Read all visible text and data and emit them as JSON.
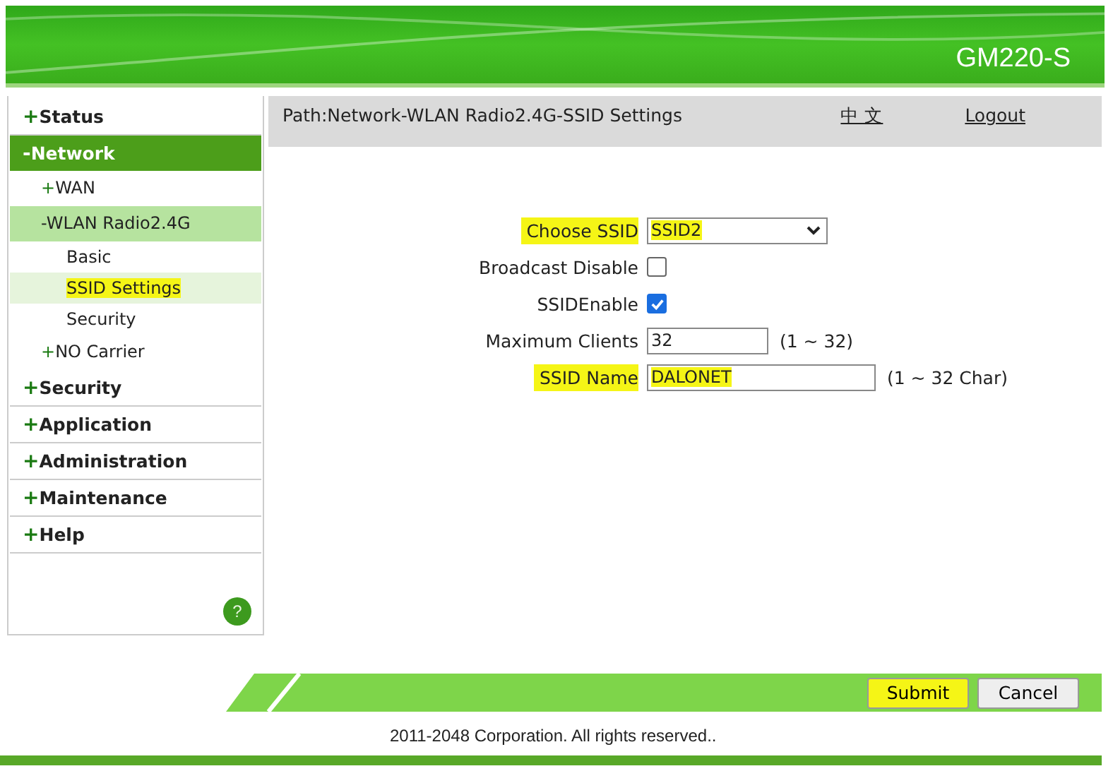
{
  "header": {
    "model": "GM220-S"
  },
  "menu": [
    {
      "toggle": "+",
      "label": "Status",
      "selected": false
    },
    {
      "toggle": "-",
      "label": "Network",
      "selected": true,
      "children": [
        {
          "toggle": "+",
          "label": "WAN",
          "selected": false
        },
        {
          "toggle": "-",
          "label": "WLAN Radio2.4G",
          "selected": true,
          "children": [
            {
              "label": "Basic",
              "selected": false,
              "highlighted": false
            },
            {
              "label": "SSID Settings",
              "selected": true,
              "highlighted": true
            },
            {
              "label": "Security",
              "selected": false,
              "highlighted": false
            }
          ]
        },
        {
          "toggle": "+",
          "label": "NO Carrier",
          "selected": false
        }
      ]
    },
    {
      "toggle": "+",
      "label": "Security",
      "selected": false
    },
    {
      "toggle": "+",
      "label": "Application",
      "selected": false
    },
    {
      "toggle": "+",
      "label": "Administration",
      "selected": false
    },
    {
      "toggle": "+",
      "label": "Maintenance",
      "selected": false
    },
    {
      "toggle": "+",
      "label": "Help",
      "selected": false
    }
  ],
  "help_button": {
    "label": "?"
  },
  "path_bar": {
    "path": "Path:Network-WLAN Radio2.4G-SSID Settings",
    "language": "中 文",
    "logout": "Logout"
  },
  "form": [
    {
      "kind": "select",
      "label": "Choose SSID",
      "value": "SSID2",
      "highlighted": true
    },
    {
      "kind": "checkbox",
      "label": "Broadcast Disable",
      "checked": false,
      "highlighted": false
    },
    {
      "kind": "checkbox",
      "label": "SSIDEnable",
      "checked": true,
      "highlighted": false
    },
    {
      "kind": "text",
      "label": "Maximum Clients",
      "value": "32",
      "hint": "(1 ~ 32)",
      "highlighted": false
    },
    {
      "kind": "text",
      "label": "SSID Name",
      "value": "DALONET",
      "hint": "(1 ~ 32 Char)",
      "highlighted": true
    }
  ],
  "buttons": [
    {
      "label": "Submit",
      "highlighted": true
    },
    {
      "label": "Cancel",
      "highlighted": false
    }
  ],
  "footer": {
    "copyright": "2011-2048 Corporation. All rights reserved.."
  }
}
